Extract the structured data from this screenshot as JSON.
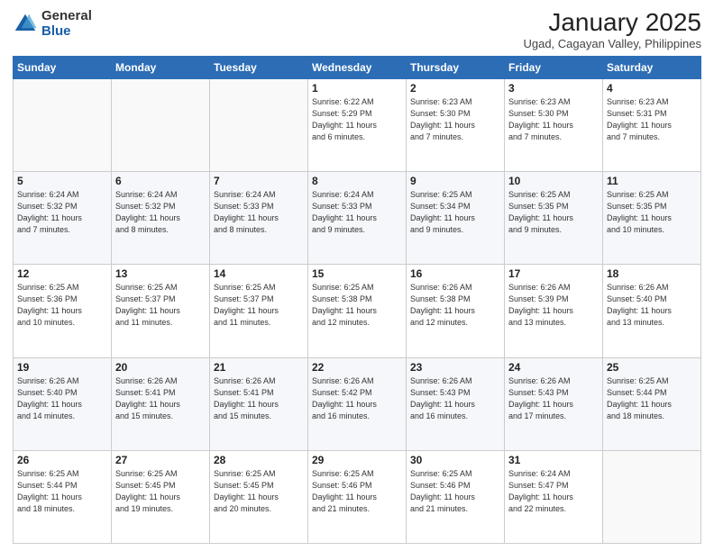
{
  "logo": {
    "general": "General",
    "blue": "Blue"
  },
  "title": "January 2025",
  "subtitle": "Ugad, Cagayan Valley, Philippines",
  "days_header": [
    "Sunday",
    "Monday",
    "Tuesday",
    "Wednesday",
    "Thursday",
    "Friday",
    "Saturday"
  ],
  "weeks": [
    [
      {
        "num": "",
        "info": ""
      },
      {
        "num": "",
        "info": ""
      },
      {
        "num": "",
        "info": ""
      },
      {
        "num": "1",
        "info": "Sunrise: 6:22 AM\nSunset: 5:29 PM\nDaylight: 11 hours\nand 6 minutes."
      },
      {
        "num": "2",
        "info": "Sunrise: 6:23 AM\nSunset: 5:30 PM\nDaylight: 11 hours\nand 7 minutes."
      },
      {
        "num": "3",
        "info": "Sunrise: 6:23 AM\nSunset: 5:30 PM\nDaylight: 11 hours\nand 7 minutes."
      },
      {
        "num": "4",
        "info": "Sunrise: 6:23 AM\nSunset: 5:31 PM\nDaylight: 11 hours\nand 7 minutes."
      }
    ],
    [
      {
        "num": "5",
        "info": "Sunrise: 6:24 AM\nSunset: 5:32 PM\nDaylight: 11 hours\nand 7 minutes."
      },
      {
        "num": "6",
        "info": "Sunrise: 6:24 AM\nSunset: 5:32 PM\nDaylight: 11 hours\nand 8 minutes."
      },
      {
        "num": "7",
        "info": "Sunrise: 6:24 AM\nSunset: 5:33 PM\nDaylight: 11 hours\nand 8 minutes."
      },
      {
        "num": "8",
        "info": "Sunrise: 6:24 AM\nSunset: 5:33 PM\nDaylight: 11 hours\nand 9 minutes."
      },
      {
        "num": "9",
        "info": "Sunrise: 6:25 AM\nSunset: 5:34 PM\nDaylight: 11 hours\nand 9 minutes."
      },
      {
        "num": "10",
        "info": "Sunrise: 6:25 AM\nSunset: 5:35 PM\nDaylight: 11 hours\nand 9 minutes."
      },
      {
        "num": "11",
        "info": "Sunrise: 6:25 AM\nSunset: 5:35 PM\nDaylight: 11 hours\nand 10 minutes."
      }
    ],
    [
      {
        "num": "12",
        "info": "Sunrise: 6:25 AM\nSunset: 5:36 PM\nDaylight: 11 hours\nand 10 minutes."
      },
      {
        "num": "13",
        "info": "Sunrise: 6:25 AM\nSunset: 5:37 PM\nDaylight: 11 hours\nand 11 minutes."
      },
      {
        "num": "14",
        "info": "Sunrise: 6:25 AM\nSunset: 5:37 PM\nDaylight: 11 hours\nand 11 minutes."
      },
      {
        "num": "15",
        "info": "Sunrise: 6:25 AM\nSunset: 5:38 PM\nDaylight: 11 hours\nand 12 minutes."
      },
      {
        "num": "16",
        "info": "Sunrise: 6:26 AM\nSunset: 5:38 PM\nDaylight: 11 hours\nand 12 minutes."
      },
      {
        "num": "17",
        "info": "Sunrise: 6:26 AM\nSunset: 5:39 PM\nDaylight: 11 hours\nand 13 minutes."
      },
      {
        "num": "18",
        "info": "Sunrise: 6:26 AM\nSunset: 5:40 PM\nDaylight: 11 hours\nand 13 minutes."
      }
    ],
    [
      {
        "num": "19",
        "info": "Sunrise: 6:26 AM\nSunset: 5:40 PM\nDaylight: 11 hours\nand 14 minutes."
      },
      {
        "num": "20",
        "info": "Sunrise: 6:26 AM\nSunset: 5:41 PM\nDaylight: 11 hours\nand 15 minutes."
      },
      {
        "num": "21",
        "info": "Sunrise: 6:26 AM\nSunset: 5:41 PM\nDaylight: 11 hours\nand 15 minutes."
      },
      {
        "num": "22",
        "info": "Sunrise: 6:26 AM\nSunset: 5:42 PM\nDaylight: 11 hours\nand 16 minutes."
      },
      {
        "num": "23",
        "info": "Sunrise: 6:26 AM\nSunset: 5:43 PM\nDaylight: 11 hours\nand 16 minutes."
      },
      {
        "num": "24",
        "info": "Sunrise: 6:26 AM\nSunset: 5:43 PM\nDaylight: 11 hours\nand 17 minutes."
      },
      {
        "num": "25",
        "info": "Sunrise: 6:25 AM\nSunset: 5:44 PM\nDaylight: 11 hours\nand 18 minutes."
      }
    ],
    [
      {
        "num": "26",
        "info": "Sunrise: 6:25 AM\nSunset: 5:44 PM\nDaylight: 11 hours\nand 18 minutes."
      },
      {
        "num": "27",
        "info": "Sunrise: 6:25 AM\nSunset: 5:45 PM\nDaylight: 11 hours\nand 19 minutes."
      },
      {
        "num": "28",
        "info": "Sunrise: 6:25 AM\nSunset: 5:45 PM\nDaylight: 11 hours\nand 20 minutes."
      },
      {
        "num": "29",
        "info": "Sunrise: 6:25 AM\nSunset: 5:46 PM\nDaylight: 11 hours\nand 21 minutes."
      },
      {
        "num": "30",
        "info": "Sunrise: 6:25 AM\nSunset: 5:46 PM\nDaylight: 11 hours\nand 21 minutes."
      },
      {
        "num": "31",
        "info": "Sunrise: 6:24 AM\nSunset: 5:47 PM\nDaylight: 11 hours\nand 22 minutes."
      },
      {
        "num": "",
        "info": ""
      }
    ]
  ]
}
